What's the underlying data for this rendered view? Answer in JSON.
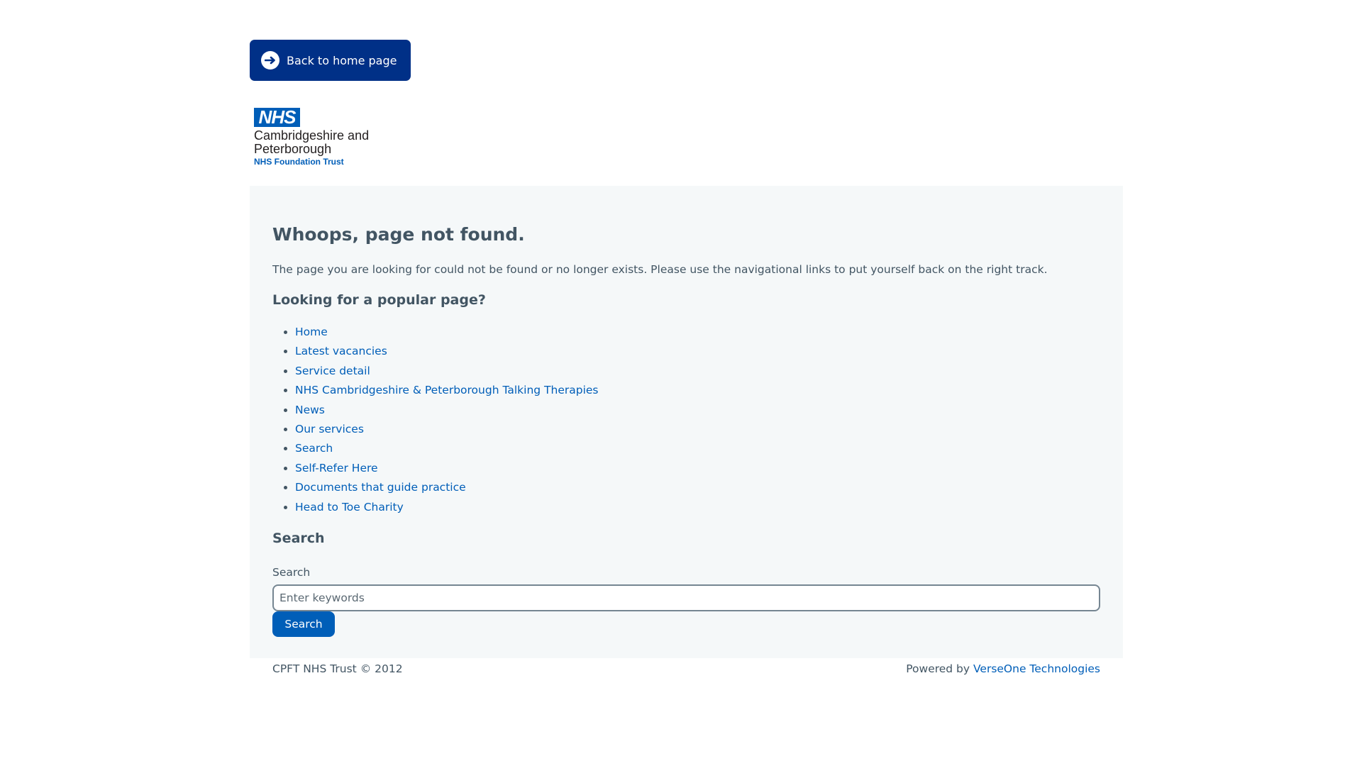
{
  "header": {
    "back_button_label": "Back to home page",
    "back_button_icon": "arrow-right-circle-icon"
  },
  "logo": {
    "badge": "NHS",
    "org_name": "Cambridgeshire and Peterborough",
    "trust_name": "NHS Foundation Trust"
  },
  "main": {
    "title": "Whoops, page not found.",
    "intro": "The page you are looking for could not be found or no longer exists. Please use the navigational links to put yourself back on the right track.",
    "popular_heading": "Looking for a popular page?",
    "popular_links": [
      "Home",
      "Latest vacancies",
      "Service detail",
      "NHS Cambridgeshire & Peterborough Talking Therapies",
      "News",
      "Our services",
      "Search",
      "Self-Refer Here",
      "Documents that guide practice",
      "Head to Toe Charity"
    ],
    "search": {
      "heading": "Search",
      "label": "Search",
      "placeholder": "Enter keywords",
      "value": "",
      "button_label": "Search"
    }
  },
  "footer": {
    "copyright": "CPFT NHS Trust © 2012",
    "powered_prefix": "Powered by",
    "powered_link": "VerseOne Technologies"
  },
  "colors": {
    "nhs_dark_blue": "#003087",
    "nhs_blue": "#005eb8",
    "text": "#425563",
    "content_background": "#f5f8f9"
  }
}
